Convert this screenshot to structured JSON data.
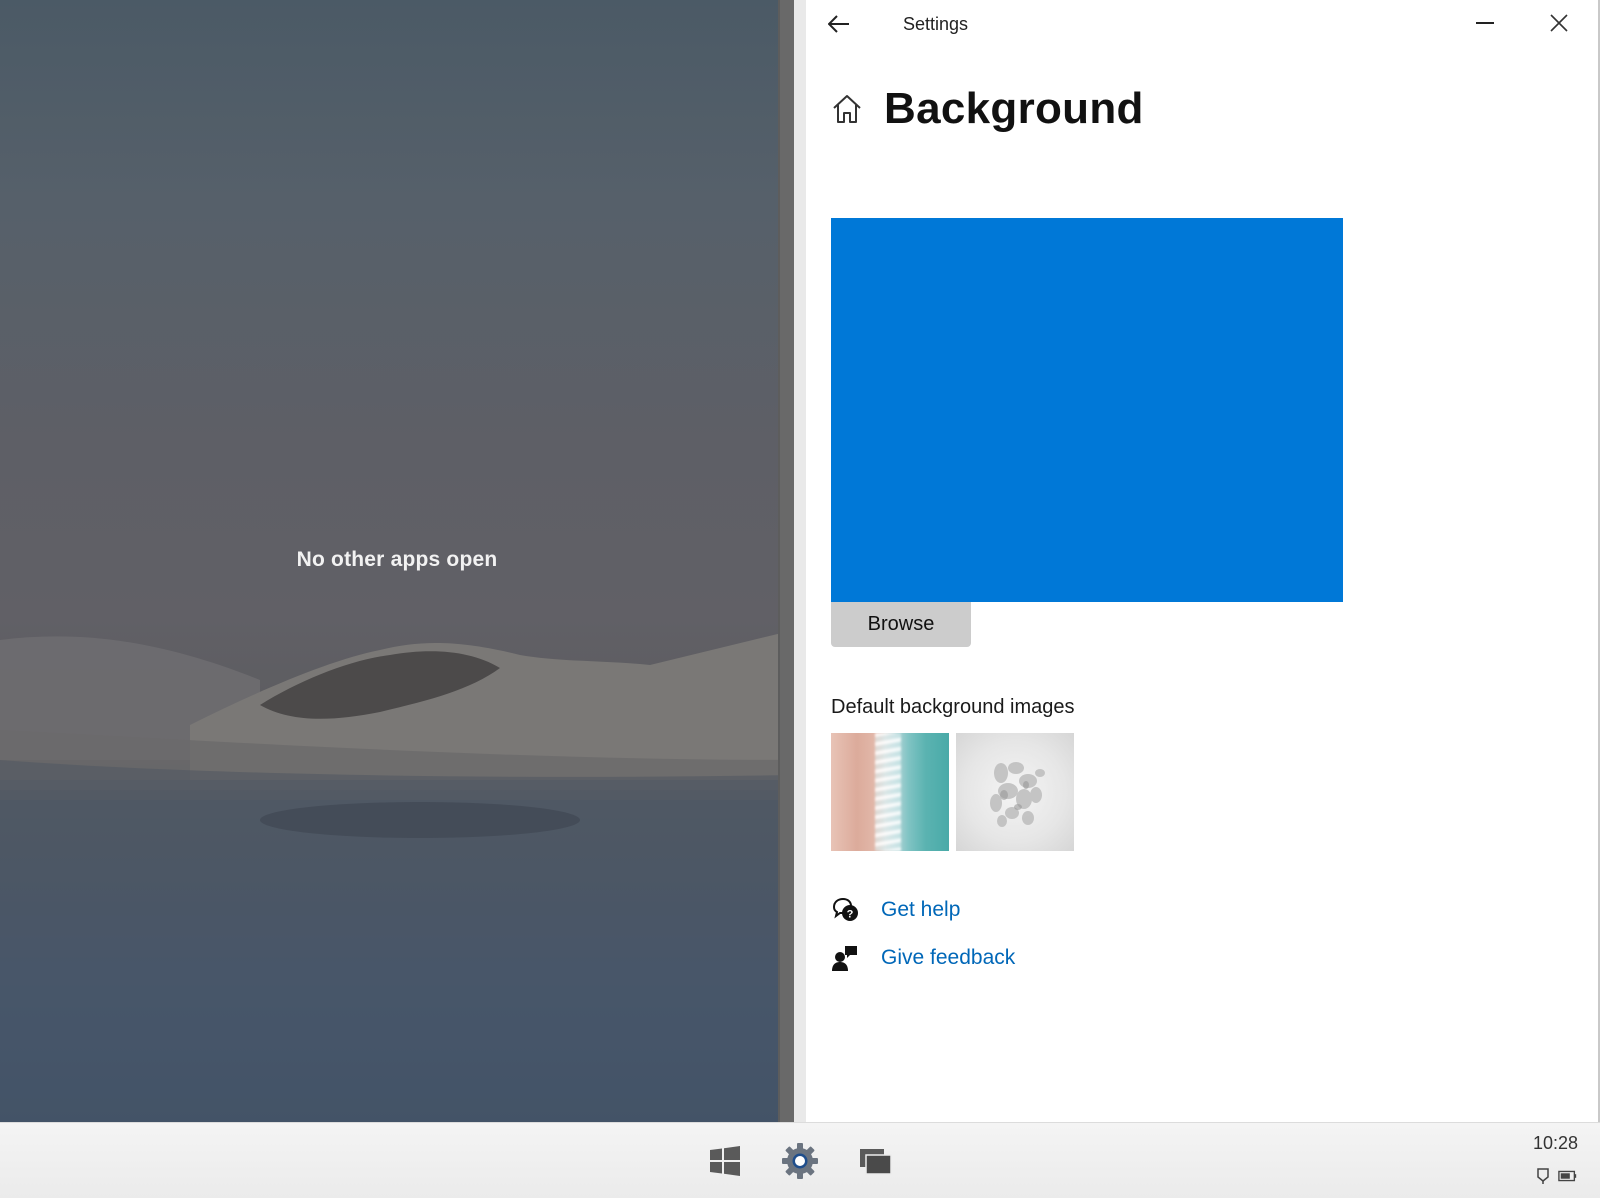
{
  "desktop": {
    "message": "No other apps open"
  },
  "settings_window": {
    "title": "Settings",
    "back_icon": "arrow-left-icon",
    "minimize_icon": "minimize-icon",
    "close_icon": "close-icon",
    "page": {
      "home_icon": "home-icon",
      "title": "Background",
      "preview_color": "#0078d7",
      "browse_label": "Browse",
      "default_images_label": "Default background images",
      "default_images": [
        {
          "name": "beach-aerial"
        },
        {
          "name": "abstract-white-shapes"
        }
      ],
      "links": [
        {
          "icon": "get-help-icon",
          "label": "Get help"
        },
        {
          "icon": "give-feedback-icon",
          "label": "Give feedback"
        }
      ]
    }
  },
  "taskbar": {
    "buttons": [
      {
        "icon": "windows-start-icon"
      },
      {
        "icon": "settings-gear-icon"
      },
      {
        "icon": "task-view-icon"
      }
    ],
    "clock": "10:28",
    "tray": [
      {
        "icon": "network-icon"
      },
      {
        "icon": "battery-icon"
      }
    ]
  },
  "colors": {
    "accent": "#0078d7",
    "link": "#0067b8",
    "button_bg": "#cccccc"
  }
}
